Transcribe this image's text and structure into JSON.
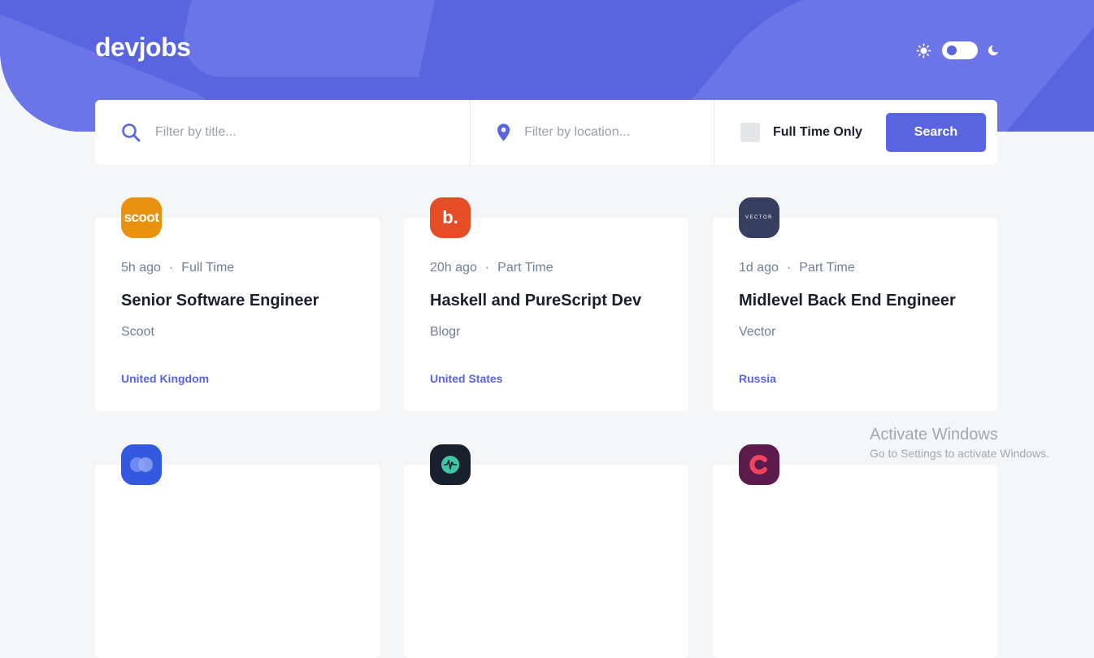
{
  "header": {
    "logo": "devjobs"
  },
  "theme_toggle": {
    "light_icon": "sun-icon",
    "dark_icon": "moon-icon"
  },
  "filter": {
    "title_placeholder": "Filter by title...",
    "location_placeholder": "Filter by location...",
    "full_time_label": "Full Time Only",
    "search_label": "Search"
  },
  "jobs": [
    {
      "logo_text": "scoot",
      "logo_color": "#e99210",
      "posted": "5h ago",
      "type": "Full Time",
      "title": "Senior Software Engineer",
      "company": "Scoot",
      "location": "United Kingdom"
    },
    {
      "logo_text": "b.",
      "logo_color": "#e54d26",
      "posted": "20h ago",
      "type": "Part Time",
      "title": "Haskell and PureScript Dev",
      "company": "Blogr",
      "location": "United States"
    },
    {
      "logo_text": "VECTOR",
      "logo_color": "#363f5f",
      "posted": "1d ago",
      "type": "Part Time",
      "title": "Midlevel Back End Engineer",
      "company": "Vector",
      "location": "Russia"
    },
    {
      "logo_text": "",
      "logo_color": "#3259de"
    },
    {
      "logo_text": "",
      "logo_color": "#19202d"
    },
    {
      "logo_text": "",
      "logo_color": "#5c1b4c"
    }
  ],
  "watermark": {
    "line1": "Activate Windows",
    "line2": "Go to Settings to activate Windows."
  }
}
